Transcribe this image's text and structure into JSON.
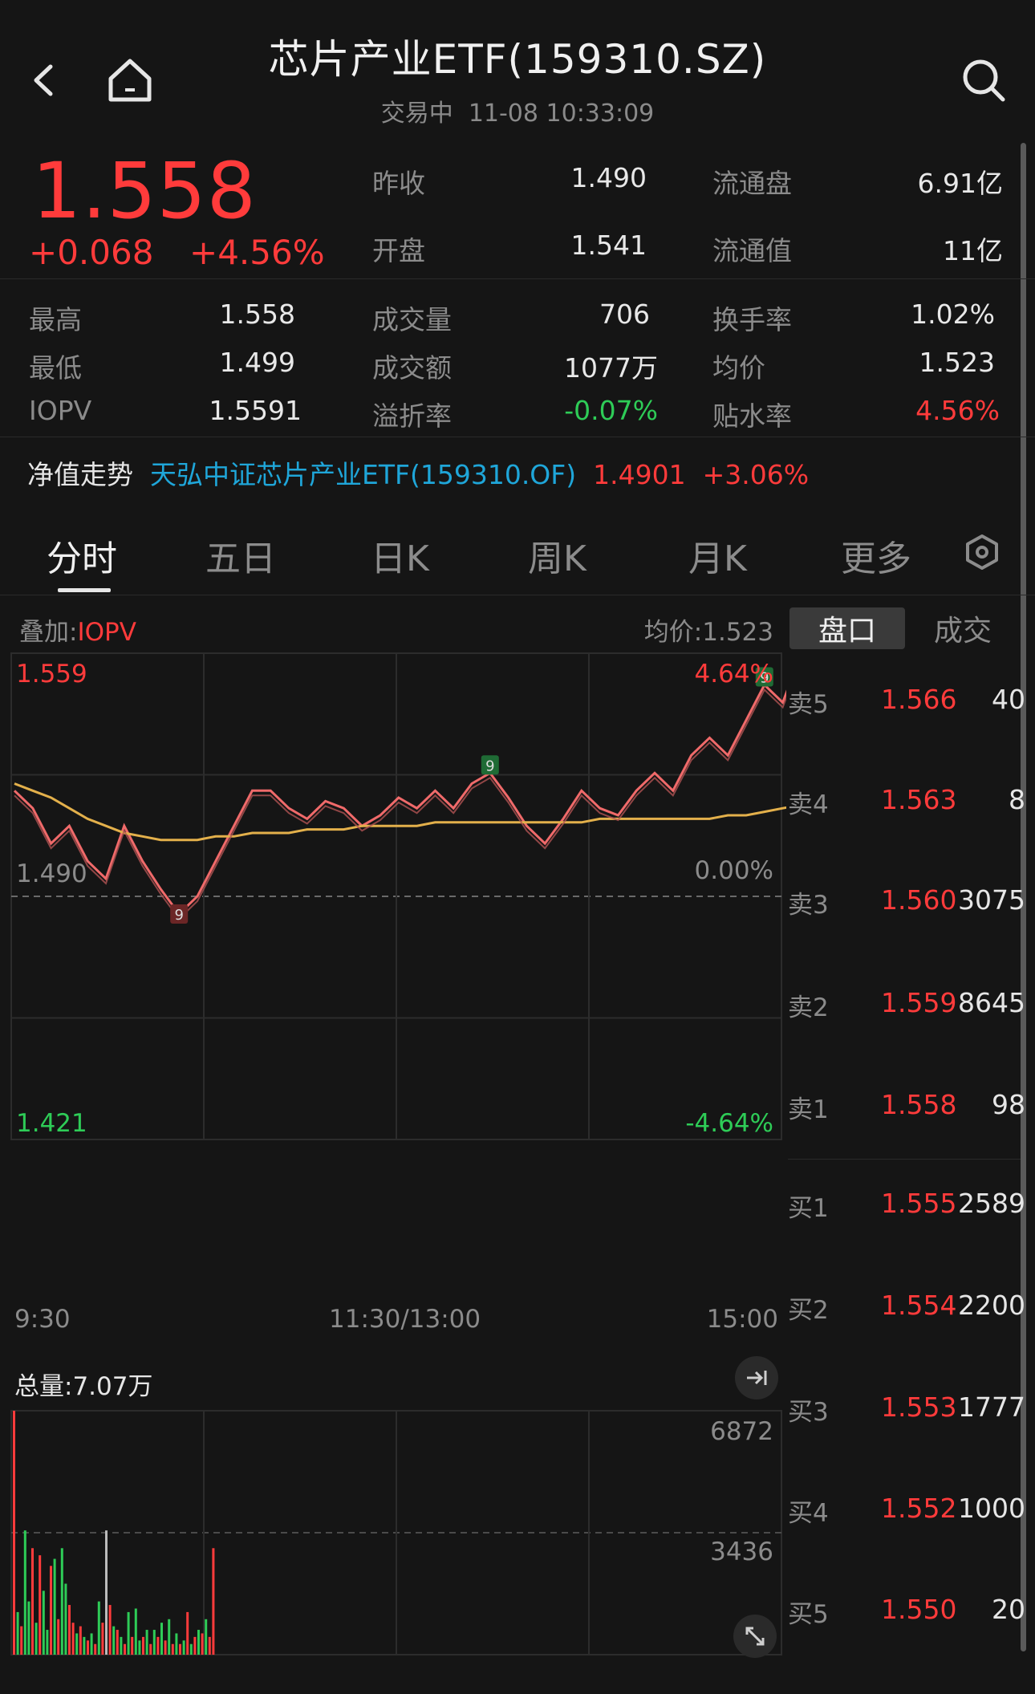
{
  "header": {
    "title": "芯片产业ETF(159310.SZ)",
    "status": "交易中",
    "datetime": "11-08 10:33:09"
  },
  "quote": {
    "price": "1.558",
    "change": "+0.068",
    "change_pct": "+4.56%",
    "prev_close_label": "昨收",
    "prev_close": "1.490",
    "open_label": "开盘",
    "open": "1.541",
    "float_shares_label": "流通盘",
    "float_shares": "6.91亿",
    "float_value_label": "流通值",
    "float_value": "11亿",
    "high_label": "最高",
    "high": "1.558",
    "low_label": "最低",
    "low": "1.499",
    "iopv_label": "IOPV",
    "iopv": "1.5591",
    "volume_label": "成交量",
    "volume": "706",
    "amount_label": "成交额",
    "amount": "1077万",
    "premium_label": "溢折率",
    "premium": "-0.07%",
    "turnover_label": "换手率",
    "turnover": "1.02%",
    "avg_label": "均价",
    "avg": "1.523",
    "discount_label": "贴水率",
    "discount": "4.56%"
  },
  "nav": {
    "label": "净值走势",
    "fund_name": "天弘中证芯片产业ETF(159310.OF)",
    "nav_value": "1.4901",
    "nav_change": "+3.06%"
  },
  "tabs": [
    {
      "label": "分时"
    },
    {
      "label": "五日"
    },
    {
      "label": "日K"
    },
    {
      "label": "周K"
    },
    {
      "label": "月K"
    },
    {
      "label": "更多"
    }
  ],
  "chart_info": {
    "overlay_prefix": "叠加:",
    "overlay_value": "IOPV",
    "avg_price_label": "均价:1.523",
    "total_volume_label": "总量:7.07万"
  },
  "orderbook_tabs": [
    "盘口",
    "成交"
  ],
  "orderbook": {
    "asks": [
      {
        "label": "卖5",
        "price": "1.566",
        "vol": "40"
      },
      {
        "label": "卖4",
        "price": "1.563",
        "vol": "8"
      },
      {
        "label": "卖3",
        "price": "1.560",
        "vol": "3075"
      },
      {
        "label": "卖2",
        "price": "1.559",
        "vol": "8645"
      },
      {
        "label": "卖1",
        "price": "1.558",
        "vol": "98"
      }
    ],
    "bids": [
      {
        "label": "买1",
        "price": "1.555",
        "vol": "2589"
      },
      {
        "label": "买2",
        "price": "1.554",
        "vol": "2200"
      },
      {
        "label": "买3",
        "price": "1.553",
        "vol": "1777"
      },
      {
        "label": "买4",
        "price": "1.552",
        "vol": "1000"
      },
      {
        "label": "买5",
        "price": "1.550",
        "vol": "20"
      }
    ]
  },
  "chart_data": {
    "type": "line",
    "y_axis_left": [
      "1.559",
      "1.490",
      "1.421"
    ],
    "y_axis_right": [
      "4.64%",
      "0.00%",
      "-4.64%"
    ],
    "x_axis": [
      "9:30",
      "11:30/13:00",
      "15:00"
    ],
    "ylim": [
      1.421,
      1.559
    ],
    "prev_close": 1.49,
    "series": [
      {
        "values": [
          1.52,
          1.515,
          1.505,
          1.51,
          1.5,
          1.495,
          1.51,
          1.5,
          1.492,
          1.485,
          1.49,
          1.5,
          1.51,
          1.52,
          1.52,
          1.515,
          1.512,
          1.517,
          1.515,
          1.51,
          1.513,
          1.518,
          1.515,
          1.52,
          1.515,
          1.522,
          1.525,
          1.518,
          1.51,
          1.505,
          1.512,
          1.52,
          1.515,
          1.513,
          1.52,
          1.525,
          1.52,
          1.53,
          1.535,
          1.53,
          1.54,
          1.55,
          1.545,
          1.559
        ]
      },
      {
        "values": [
          1.522,
          1.52,
          1.518,
          1.515,
          1.512,
          1.51,
          1.508,
          1.507,
          1.506,
          1.506,
          1.506,
          1.507,
          1.507,
          1.508,
          1.508,
          1.508,
          1.509,
          1.509,
          1.509,
          1.51,
          1.51,
          1.51,
          1.51,
          1.511,
          1.511,
          1.511,
          1.511,
          1.511,
          1.511,
          1.511,
          1.511,
          1.511,
          1.512,
          1.512,
          1.512,
          1.512,
          1.512,
          1.512,
          1.512,
          1.513,
          1.513,
          1.514,
          1.515,
          1.516
        ]
      }
    ],
    "markers": [
      {
        "index": 9,
        "label": "9"
      },
      {
        "index": 26,
        "label": "9"
      },
      {
        "index": 41,
        "label": "9"
      }
    ],
    "volume": {
      "ylim": [
        0,
        6872
      ],
      "ticks": [
        "6872",
        "3436"
      ],
      "values": [
        6872,
        1200,
        800,
        3500,
        1500,
        3000,
        900,
        2800,
        1800,
        700,
        2500,
        2700,
        1000,
        3000,
        2000,
        1400,
        900,
        600,
        800,
        500,
        400,
        600,
        300,
        1500,
        900,
        3500,
        1400,
        800,
        700,
        500,
        300,
        1200,
        500,
        1300,
        400,
        500,
        700,
        300,
        700,
        500,
        900,
        400,
        1000,
        300,
        600,
        300,
        400,
        1200,
        300,
        500,
        700,
        600,
        1000,
        500,
        3000
      ],
      "colors": [
        "r",
        "g",
        "r",
        "g",
        "g",
        "r",
        "g",
        "r",
        "g",
        "g",
        "r",
        "g",
        "r",
        "g",
        "g",
        "r",
        "r",
        "g",
        "r",
        "g",
        "r",
        "g",
        "r",
        "g",
        "r",
        "w",
        "r",
        "g",
        "r",
        "g",
        "r",
        "g",
        "r",
        "g",
        "g",
        "r",
        "g",
        "r",
        "g",
        "r",
        "g",
        "r",
        "g",
        "r",
        "g",
        "r",
        "g",
        "r",
        "g",
        "r",
        "g",
        "r",
        "g",
        "r",
        "r"
      ]
    }
  }
}
